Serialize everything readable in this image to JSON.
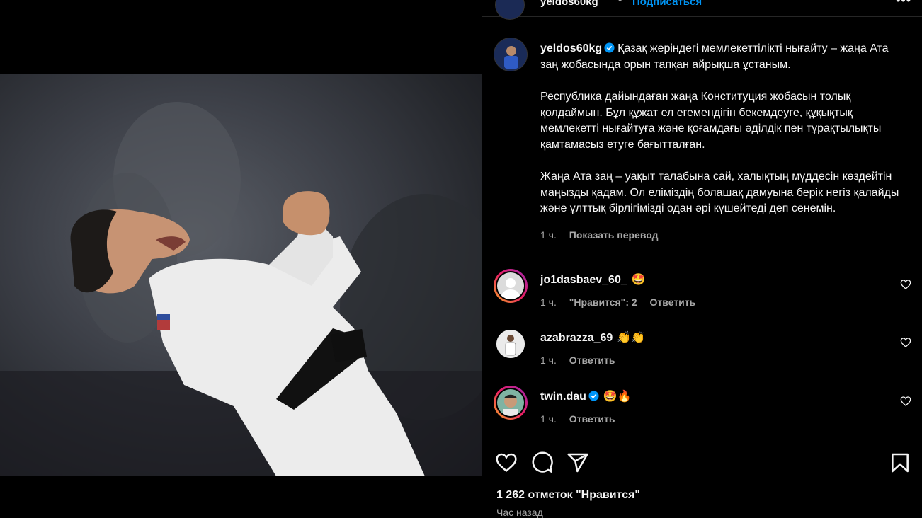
{
  "post": {
    "username": "yeldos60kg",
    "follow_label": "Подписаться",
    "header_separator": "•",
    "more_label": "•••",
    "caption": {
      "line1": "Қазақ жеріндегі мемлекеттілікті нығайту – жаңа Ата заң жобасында орын тапқан айрықша ұстаным.",
      "line2": "Республика дайындаған жаңа Конституция жобасын толық қолдаймын. Бұл құжат ел егемендігін бекемдеуге, құқықтық мемлекетті нығайтуға және қоғамдағы әділдік пен тұрақтылықты қамтамасыз етуге бағытталған.",
      "line3": "Жаңа Ата заң – уақыт талабына сай, халықтың мүддесін көздейтін маңызды қадам. Ол еліміздің болашақ дамуына берік негіз қалайды және ұлттық бірлігімізді одан әрі күшейтеді деп сенемін."
    },
    "caption_time": "1 ч.",
    "translate_label": "Показать перевод",
    "likes": "1 262 отметок \"Нравится\"",
    "posted": "Час назад"
  },
  "comments": [
    {
      "username": "jo1dasbaev_60_",
      "emoji": "🤩",
      "time": "1 ч.",
      "likes": "\"Нравится\": 2",
      "reply": "Ответить",
      "verified": false
    },
    {
      "username": "azabrazza_69",
      "emoji": "👏👏",
      "time": "1 ч.",
      "likes": "",
      "reply": "Ответить",
      "verified": false
    },
    {
      "username": "twin.dau",
      "emoji": "🤩🔥",
      "time": "1 ч.",
      "likes": "",
      "reply": "Ответить",
      "verified": true
    }
  ],
  "colors": {
    "background": "#000000",
    "text": "#f5f5f5",
    "secondary": "#a8a8a8",
    "accent": "#0095f6",
    "verified": "#0095f6"
  },
  "icons": [
    "heart-icon",
    "comment-icon",
    "share-icon",
    "bookmark-icon",
    "verified-icon",
    "more-icon"
  ]
}
